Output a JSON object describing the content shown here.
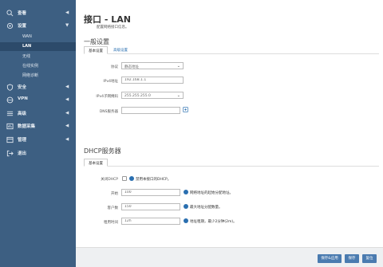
{
  "sidebar": {
    "bg_color": "#3d5f82",
    "items": [
      {
        "icon": "search-icon",
        "label": "查看"
      },
      {
        "icon": "gear-icon",
        "label": "设置"
      },
      {
        "icon": "shield-icon",
        "label": "安全"
      },
      {
        "icon": "vpn-icon",
        "label": "VPN"
      },
      {
        "icon": "advanced-icon",
        "label": "高级"
      },
      {
        "icon": "data-icon",
        "label": "数据采集"
      },
      {
        "icon": "manage-icon",
        "label": "管理"
      },
      {
        "icon": "logout-icon",
        "label": "退出"
      }
    ],
    "sub_items": [
      {
        "label": "WAN"
      },
      {
        "label": "LAN"
      },
      {
        "label": "无线"
      },
      {
        "label": "在线实例"
      },
      {
        "label": "网络诊断"
      }
    ]
  },
  "page": {
    "title": "接口 - LAN",
    "subtitle": "配置网络接口信息。"
  },
  "general": {
    "title": "一般设置",
    "tab_basic": "基本设置",
    "tab_advanced": "高级设置",
    "protocol_label": "协议",
    "protocol_value": "静态地址",
    "ipv4_label": "IPv4地址",
    "ipv4_value": "192.168.1.1",
    "mask_label": "IPv4子网掩码",
    "mask_value": "255.255.255.0",
    "dns_label": "DNS服务器",
    "dns_value": ""
  },
  "dhcp": {
    "title": "DHCP服务器",
    "tab_basic": "基本设置",
    "disable_label": "关闭DHCP",
    "disable_hint": "禁用本接口的DHCP。",
    "start_label": "开始",
    "start_value": "100",
    "start_hint": "网络地址的起始分配地址。",
    "clients_label": "客户数",
    "clients_value": "150",
    "clients_hint": "最大地址分配数量。",
    "lease_label": "租用时间",
    "lease_value": "12h",
    "lease_hint": "地址租期，最少2分钟(2m)。"
  },
  "actions": {
    "save_apply": "保存&应用",
    "save": "保存",
    "reset": "复位"
  }
}
